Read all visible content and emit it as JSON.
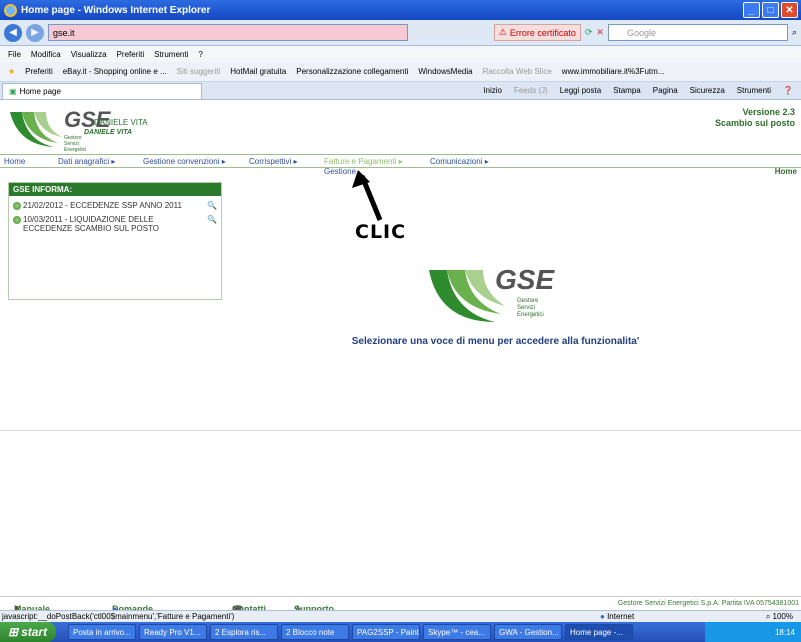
{
  "window": {
    "title": "Home page - Windows Internet Explorer"
  },
  "address": {
    "url": "gse.it",
    "cert_error": "Errore certificato",
    "search_placeholder": "Google"
  },
  "menubar": [
    "File",
    "Modifica",
    "Visualizza",
    "Preferiti",
    "Strumenti",
    "?"
  ],
  "favorites": {
    "label": "Preferiti",
    "items": [
      "eBay.it - Shopping online e ...",
      "Siti suggeriti",
      "HotMail gratuita",
      "Personalizzazione collegamenti",
      "WindowsMedia",
      "Raccolta Web Slice",
      "www.immobiliare.it%3Futm..."
    ]
  },
  "tab": {
    "label": "Home page"
  },
  "commands": [
    "Inizio",
    "Feeds (J)",
    "Leggi posta",
    "Stampa",
    "Pagina",
    "Sicurezza",
    "Strumenti"
  ],
  "header": {
    "logo": "GSE",
    "user": "DANIELE VITA",
    "user_sub": "DANIELE VITA",
    "logo_caption": "Gestore Servizi Energetici",
    "version": "Versione 2.3",
    "service": "Scambio sul posto"
  },
  "mainmenu": {
    "items": [
      "Home",
      "Dati anagrafici ▸",
      "Gestione convenzioni ▸",
      "Corrispettivi ▸",
      "Fatture e Pagamenti ▸",
      "Comunicazioni ▸"
    ],
    "submenu": "Gestione",
    "home_right": "Home"
  },
  "info": {
    "title": "GSE INFORMA:",
    "items": [
      "21/02/2012 - ECCEDENZE SSP ANNO 2011",
      "10/03/2011 - LIQUIDAZIONE DELLE ECCEDENZE SCAMBIO SUL POSTO"
    ]
  },
  "annotation": {
    "clic": "CLIC"
  },
  "center": {
    "logo": "GSE",
    "caption": "Gestore Servizi Energetici",
    "message": "Selezionare una voce di menu per accedere alla funzionalita'"
  },
  "footer": {
    "links": [
      "Manuale Utente",
      "Domande Frequenti (FAQ)",
      "Contatti",
      "Supporto"
    ],
    "right": "Gestore Servizi Energetici S.p.A. Partita IVA 05754381001"
  },
  "status": {
    "text": "javascript:__doPostBack('ctl00$mainmenu','Fatture e Pagamenti')",
    "zone": "Internet",
    "zoom": "100%"
  },
  "taskbar": {
    "start": "start",
    "tasks": [
      "Posta in arrivo...",
      "Ready Pro V1...",
      "2 Esplora ris...",
      "2 Blocco note",
      "PAG2SSP - Paint",
      "Skype™ - cea...",
      "GWA - Gestion...",
      "Home page -..."
    ],
    "clock": "18:14"
  }
}
